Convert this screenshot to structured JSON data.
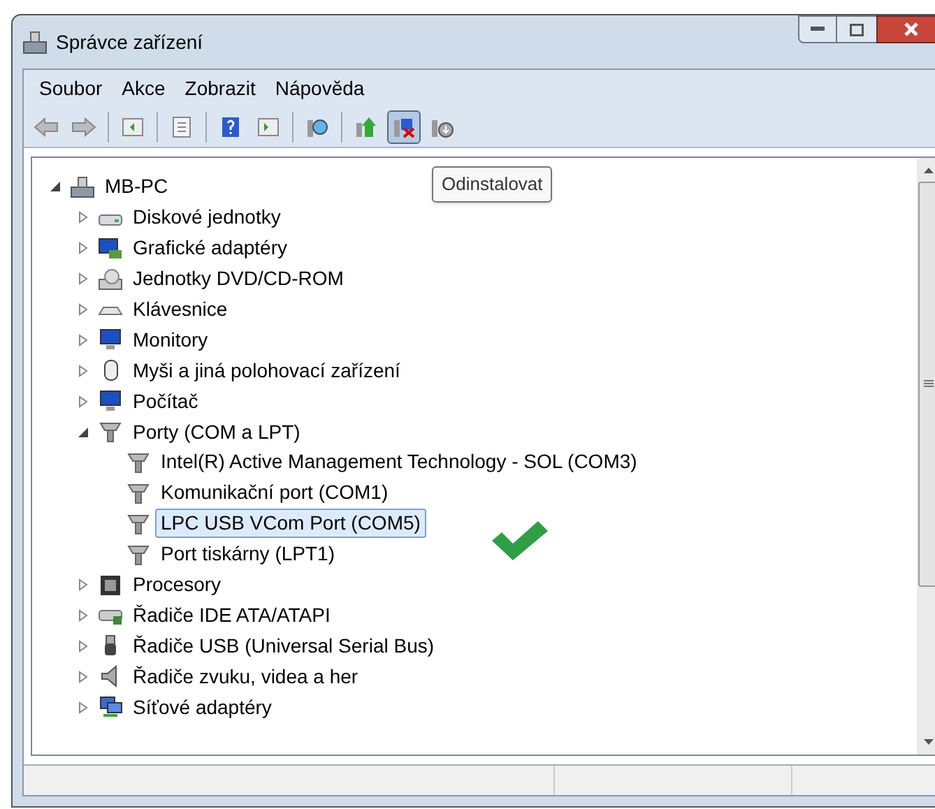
{
  "window": {
    "title": "Správce zařízení"
  },
  "menu": [
    "Soubor",
    "Akce",
    "Zobrazit",
    "Nápověda"
  ],
  "toolbar": [
    {
      "kind": "back",
      "active": false
    },
    {
      "kind": "forward",
      "active": false
    },
    {
      "kind": "separator"
    },
    {
      "kind": "tree",
      "active": false
    },
    {
      "kind": "separator"
    },
    {
      "kind": "properties",
      "active": false
    },
    {
      "kind": "separator"
    },
    {
      "kind": "help",
      "active": false
    },
    {
      "kind": "pane",
      "active": false
    },
    {
      "kind": "separator"
    },
    {
      "kind": "scan",
      "active": false
    },
    {
      "kind": "separator"
    },
    {
      "kind": "update",
      "active": false
    },
    {
      "kind": "uninstall",
      "active": true
    },
    {
      "kind": "disable",
      "active": false
    }
  ],
  "tooltip": "Odinstalovat",
  "tree": [
    {
      "label": "MB-PC",
      "kind": "computer",
      "expanded": true,
      "selected": false,
      "children": [
        {
          "label": "Diskové jednotky",
          "kind": "disk",
          "expanded": false,
          "selected": false
        },
        {
          "label": "Grafické adaptéry",
          "kind": "display",
          "expanded": false,
          "selected": false
        },
        {
          "label": "Jednotky DVD/CD-ROM",
          "kind": "dvd",
          "expanded": false,
          "selected": false
        },
        {
          "label": "Klávesnice",
          "kind": "keyboard",
          "expanded": false,
          "selected": false
        },
        {
          "label": "Monitory",
          "kind": "monitor",
          "expanded": false,
          "selected": false
        },
        {
          "label": "Myši a jiná polohovací zařízení",
          "kind": "mouse",
          "expanded": false,
          "selected": false
        },
        {
          "label": "Počítač",
          "kind": "monitor",
          "expanded": false,
          "selected": false
        },
        {
          "label": "Porty (COM a LPT)",
          "kind": "port",
          "expanded": true,
          "selected": false,
          "children": [
            {
              "label": "Intel(R) Active Management Technology - SOL (COM3)",
              "kind": "port",
              "selected": false
            },
            {
              "label": "Komunikační port (COM1)",
              "kind": "port",
              "selected": false
            },
            {
              "label": "LPC USB VCom Port (COM5)",
              "kind": "port",
              "selected": true
            },
            {
              "label": "Port tiskárny (LPT1)",
              "kind": "port",
              "selected": false
            }
          ]
        },
        {
          "label": "Procesory",
          "kind": "cpu",
          "expanded": false,
          "selected": false
        },
        {
          "label": "Řadiče IDE ATA/ATAPI",
          "kind": "ide",
          "expanded": false,
          "selected": false
        },
        {
          "label": "Řadiče USB (Universal Serial Bus)",
          "kind": "usb",
          "expanded": false,
          "selected": false
        },
        {
          "label": "Řadiče zvuku, videa a her",
          "kind": "speaker",
          "expanded": false,
          "selected": false
        },
        {
          "label": "Síťové adaptéry",
          "kind": "network",
          "expanded": false,
          "selected": false
        }
      ]
    }
  ],
  "annotation": {
    "kind": "check"
  }
}
